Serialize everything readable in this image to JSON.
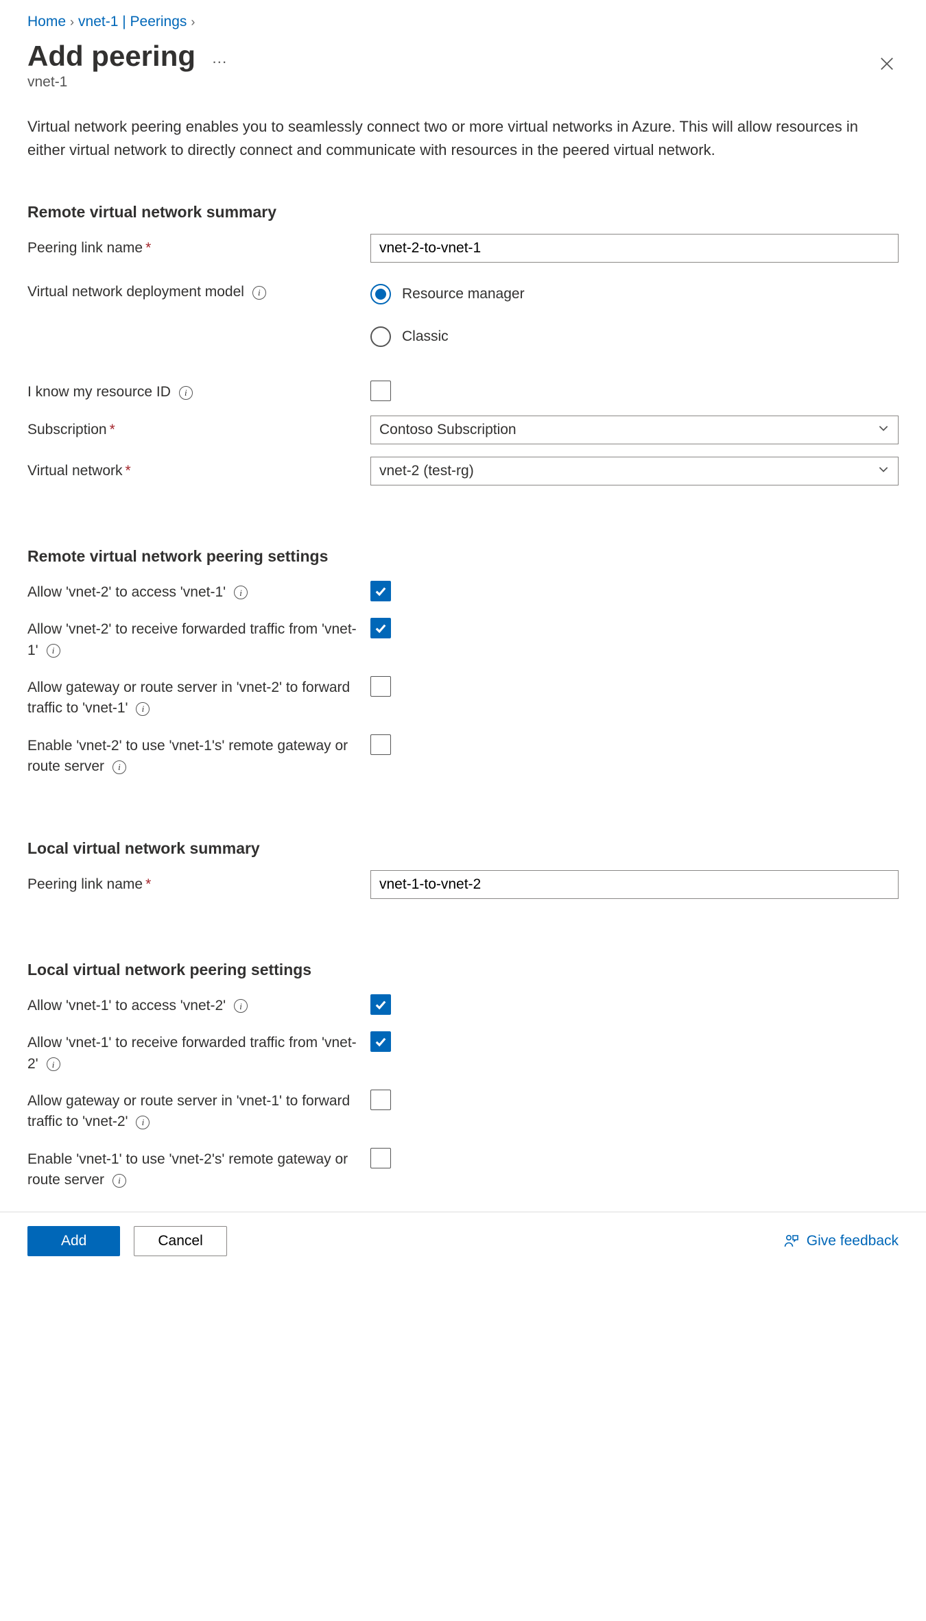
{
  "breadcrumb": {
    "home": "Home",
    "vnet": "vnet-1 | Peerings"
  },
  "header": {
    "title": "Add peering",
    "sub": "vnet-1"
  },
  "intro": "Virtual network peering enables you to seamlessly connect two or more virtual networks in Azure. This will allow resources in either virtual network to directly connect and communicate with resources in the peered virtual network.",
  "remote_summary": {
    "title": "Remote virtual network summary",
    "peering_link_label": "Peering link name",
    "peering_link_value": "vnet-2-to-vnet-1",
    "deploy_label": "Virtual network deployment model",
    "deploy_options": {
      "rm": "Resource manager",
      "classic": "Classic"
    },
    "know_id_label": "I know my resource ID",
    "sub_label": "Subscription",
    "sub_value": "Contoso Subscription",
    "vnet_label": "Virtual network",
    "vnet_value": "vnet-2 (test-rg)"
  },
  "remote_settings": {
    "title": "Remote virtual network peering settings",
    "allow_access": "Allow 'vnet-2' to access 'vnet-1'",
    "allow_fwd": "Allow 'vnet-2' to receive forwarded traffic from 'vnet-1'",
    "allow_gateway": "Allow gateway or route server in 'vnet-2' to forward traffic to 'vnet-1'",
    "enable_remote_gw": "Enable 'vnet-2' to use 'vnet-1's' remote gateway or route server"
  },
  "local_summary": {
    "title": "Local virtual network summary",
    "peering_link_label": "Peering link name",
    "peering_link_value": "vnet-1-to-vnet-2"
  },
  "local_settings": {
    "title": "Local virtual network peering settings",
    "allow_access": "Allow 'vnet-1' to access 'vnet-2'",
    "allow_fwd": "Allow 'vnet-1' to receive forwarded traffic from 'vnet-2'",
    "allow_gateway": "Allow gateway or route server in 'vnet-1' to forward traffic to 'vnet-2'",
    "enable_remote_gw": "Enable 'vnet-1' to use 'vnet-2's' remote gateway or route server"
  },
  "footer": {
    "add": "Add",
    "cancel": "Cancel",
    "feedback": "Give feedback"
  }
}
